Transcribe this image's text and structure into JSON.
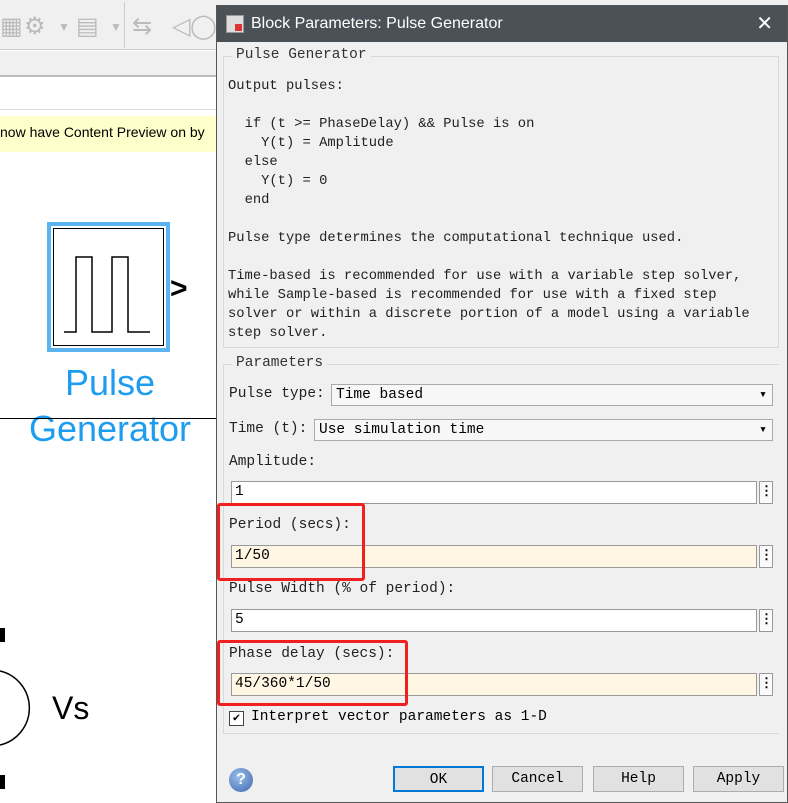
{
  "background": {
    "notice_text": "now have Content Preview on by",
    "block_label": "Pulse Generator",
    "vs_label": "Vs"
  },
  "dialog": {
    "title": "Block Parameters: Pulse Generator",
    "group_title": "Pulse Generator",
    "description": "Output pulses:\n\n  if (t >= PhaseDelay) && Pulse is on\n    Y(t) = Amplitude\n  else\n    Y(t) = 0\n  end\n\nPulse type determines the computational technique used.\n\nTime-based is recommended for use with a variable step solver,\nwhile Sample-based is recommended for use with a fixed step\nsolver or within a discrete portion of a model using a variable\nstep solver.",
    "params_title": "Parameters",
    "pulse_type_label": "Pulse type:",
    "pulse_type_value": "Time based",
    "time_label": "Time (t):",
    "time_value": "Use simulation time",
    "amplitude_label": "Amplitude:",
    "amplitude_value": "1",
    "period_label": "Period (secs):",
    "period_value": "1/50",
    "width_label": "Pulse Width (% of period):",
    "width_value": "5",
    "phase_label": "Phase delay (secs):",
    "phase_value": "45/360*1/50",
    "interpret_label": "Interpret vector parameters as 1-D",
    "interpret_checked": true,
    "buttons": {
      "ok": "OK",
      "cancel": "Cancel",
      "help": "Help",
      "apply": "Apply"
    },
    "accent_color": "#0078d7",
    "highlight_color": "#f02020"
  }
}
